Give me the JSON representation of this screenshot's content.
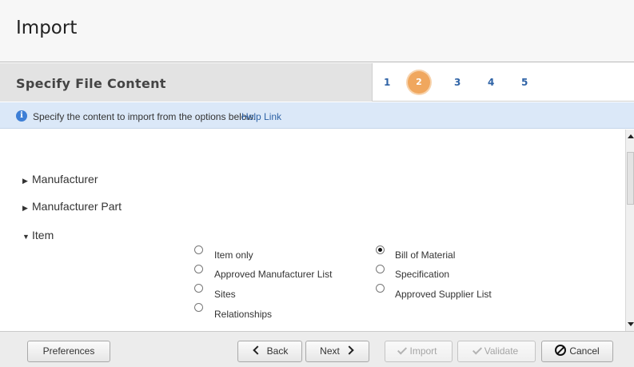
{
  "window": {
    "title": "Import"
  },
  "step_header": {
    "title": "Specify File Content",
    "steps": [
      "1",
      "2",
      "3",
      "4",
      "5"
    ],
    "active_step": "2",
    "active_color": "#f0a75e"
  },
  "info": {
    "icon": "info-icon",
    "message": "Specify the content to import from the options below.",
    "help_link": "Help Link"
  },
  "tree": [
    {
      "label": "Manufacturer",
      "expanded": false
    },
    {
      "label": "Manufacturer Part",
      "expanded": false
    },
    {
      "label": "Item",
      "expanded": true
    }
  ],
  "item_options": {
    "left": [
      "Item only",
      "Approved Manufacturer List",
      "Sites",
      "Relationships"
    ],
    "right": [
      "Bill of Material",
      "Specification",
      "Approved Supplier List"
    ],
    "selected": "Bill of Material"
  },
  "footer": {
    "preferences": "Preferences",
    "back": "Back",
    "next": "Next",
    "import": "Import",
    "validate": "Validate",
    "cancel": "Cancel"
  }
}
